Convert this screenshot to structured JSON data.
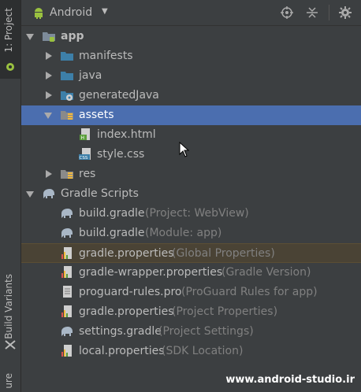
{
  "side_tabs": {
    "project": "1: Project",
    "build_variants": "Build Variants",
    "structure": "ure"
  },
  "toolbar": {
    "title": "Android",
    "caret": "▼"
  },
  "tree": {
    "app": "app",
    "manifests": "manifests",
    "java": "java",
    "generatedJava": "generatedJava",
    "assets": "assets",
    "index_html": "index.html",
    "style_css": "style.css",
    "res": "res",
    "gradle_scripts": "Gradle Scripts",
    "scripts": [
      {
        "name": "build.gradle",
        "detail": "(Project: WebView)",
        "icon": "gradle-elephant-icon"
      },
      {
        "name": "build.gradle",
        "detail": "(Module: app)",
        "icon": "gradle-elephant-icon"
      },
      {
        "name": "gradle.properties",
        "detail": "(Global Properties)",
        "icon": "properties-file-icon"
      },
      {
        "name": "gradle-wrapper.properties",
        "detail": "(Gradle Version)",
        "icon": "properties-file-icon"
      },
      {
        "name": "proguard-rules.pro",
        "detail": "(ProGuard Rules for app)",
        "icon": "text-file-icon"
      },
      {
        "name": "gradle.properties",
        "detail": "(Project Properties)",
        "icon": "properties-file-icon"
      },
      {
        "name": "settings.gradle",
        "detail": "(Project Settings)",
        "icon": "gradle-elephant-icon"
      },
      {
        "name": "local.properties",
        "detail": "(SDK Location)",
        "icon": "properties-file-icon"
      }
    ]
  },
  "watermark": "www.android-studio.ir",
  "colors": {
    "background": "#3c3f41",
    "selection": "#4b6eaf",
    "folder": "#3d7fa8",
    "android_green": "#9ac140"
  }
}
